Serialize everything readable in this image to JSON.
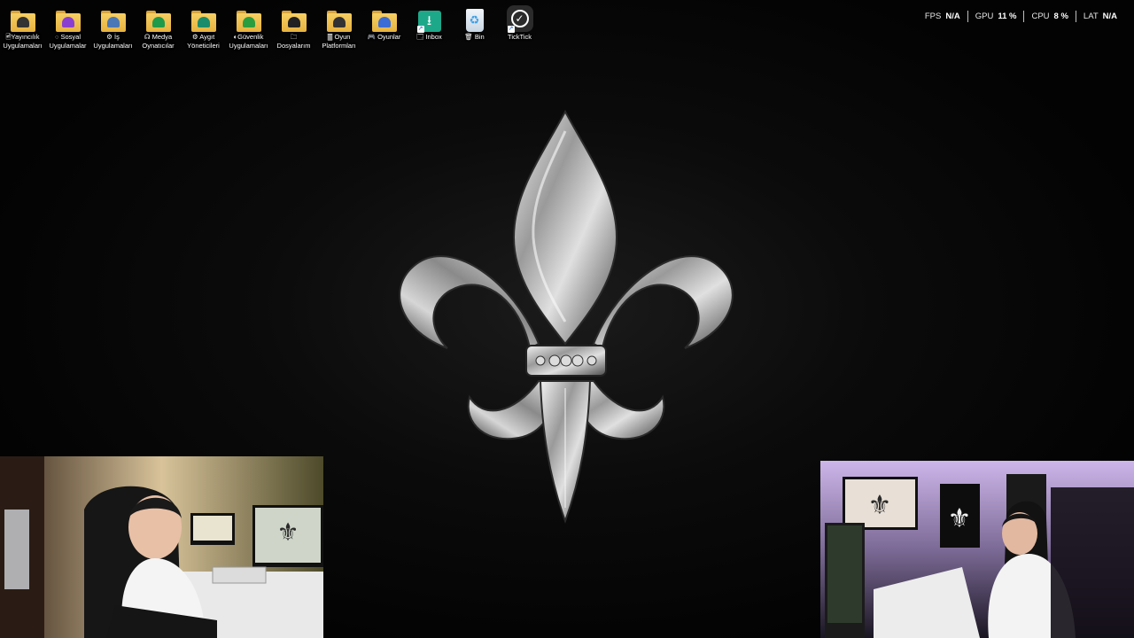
{
  "desktop": {
    "icons": [
      {
        "label": "🖻Yayıncılık\nUygulamaları",
        "icon": "folder-streaming-icon",
        "emblem": "#333333"
      },
      {
        "label": "◌ Sosyal\nUygulamalar",
        "icon": "folder-social-icon",
        "emblem": "#8b3fd1"
      },
      {
        "label": "⚙ İş\nUygulamaları",
        "icon": "folder-work-icon",
        "emblem": "#4a78b6"
      },
      {
        "label": "☊ Medya\nOynatıcılar",
        "icon": "folder-media-icon",
        "emblem": "#1f9a4a"
      },
      {
        "label": "⚙ Aygıt\nYöneticileri",
        "icon": "folder-devices-icon",
        "emblem": "#1a8c6c"
      },
      {
        "label": "◐Güvenlik\nUygulamaları",
        "icon": "folder-security-icon",
        "emblem": "#2b9d3f"
      },
      {
        "label": "🗀\nDosyalarım",
        "icon": "folder-files-icon",
        "emblem": "#222222"
      },
      {
        "label": "🀫 Oyun\nPlatformları",
        "icon": "folder-game-platforms-icon",
        "emblem": "#333333"
      },
      {
        "label": "🎮 Oyunlar",
        "icon": "folder-games-icon",
        "emblem": "#3b6cd6"
      },
      {
        "label": "🗔 Inbox",
        "icon": "inbox-download-icon",
        "emblem": "#1ea88a"
      },
      {
        "label": "🗑 Bin",
        "icon": "recycle-bin-icon",
        "emblem": "#3aa0e8"
      },
      {
        "label": "TickTick",
        "icon": "ticktick-app-icon",
        "emblem": "#2b2b2b"
      }
    ]
  },
  "perf_overlay": {
    "fps_label": "FPS",
    "fps_value": "N/A",
    "gpu_label": "GPU",
    "gpu_value": "11 %",
    "cpu_label": "CPU",
    "cpu_value": "8 %",
    "lat_label": "LAT",
    "lat_value": "N/A"
  },
  "wallpaper": {
    "motif": "silver-fleur-de-lis"
  },
  "webcams": [
    {
      "name": "webcam-front",
      "description_colors": [
        "#e8d4a8",
        "#2a2018"
      ]
    },
    {
      "name": "webcam-side",
      "description_colors": [
        "#c9b3e8",
        "#1a1622"
      ]
    }
  ]
}
